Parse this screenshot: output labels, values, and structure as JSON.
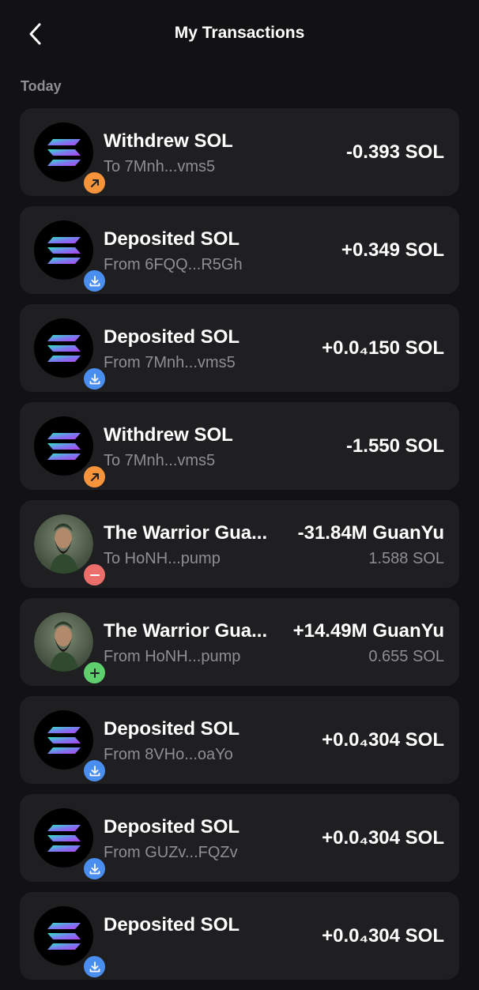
{
  "header": {
    "title": "My Transactions",
    "back_icon": "chevron-left-icon"
  },
  "section": {
    "label": "Today"
  },
  "colors": {
    "background": "#121214",
    "card": "#1f1f22",
    "withdraw_badge": "#f5943a",
    "deposit_badge": "#4a8ff0",
    "sell_badge": "#ec6e6b",
    "buy_badge": "#5fce6d"
  },
  "transactions": [
    {
      "kind": "withdraw",
      "avatar": "solana-logo",
      "badge_icon": "arrow-up-right-icon",
      "name": "Withdrew SOL",
      "sub": "To 7Mnh...vms5",
      "amount": "-0.393 SOL",
      "amount_sub": ""
    },
    {
      "kind": "deposit",
      "avatar": "solana-logo",
      "badge_icon": "download-icon",
      "name": "Deposited SOL",
      "sub": "From 6FQQ...R5Gh",
      "amount": "+0.349 SOL",
      "amount_sub": ""
    },
    {
      "kind": "deposit",
      "avatar": "solana-logo",
      "badge_icon": "download-icon",
      "name": "Deposited SOL",
      "sub": "From 7Mnh...vms5",
      "amount": "+0.0₄150 SOL",
      "amount_sub": ""
    },
    {
      "kind": "withdraw",
      "avatar": "solana-logo",
      "badge_icon": "arrow-up-right-icon",
      "name": "Withdrew SOL",
      "sub": "To 7Mnh...vms5",
      "amount": "-1.550 SOL",
      "amount_sub": ""
    },
    {
      "kind": "sell",
      "avatar": "warrior-token-image",
      "badge_icon": "minus-icon",
      "name": "The Warrior Gua...",
      "sub": "To HoNH...pump",
      "amount": "-31.84M GuanYu",
      "amount_sub": "1.588 SOL"
    },
    {
      "kind": "buy",
      "avatar": "warrior-token-image",
      "badge_icon": "plus-icon",
      "name": "The Warrior Gua...",
      "sub": "From HoNH...pump",
      "amount": "+14.49M GuanYu",
      "amount_sub": "0.655 SOL"
    },
    {
      "kind": "deposit",
      "avatar": "solana-logo",
      "badge_icon": "download-icon",
      "name": "Deposited SOL",
      "sub": "From 8VHo...oaYo",
      "amount": "+0.0₄304 SOL",
      "amount_sub": ""
    },
    {
      "kind": "deposit",
      "avatar": "solana-logo",
      "badge_icon": "download-icon",
      "name": "Deposited SOL",
      "sub": "From GUZv...FQZv",
      "amount": "+0.0₄304 SOL",
      "amount_sub": ""
    },
    {
      "kind": "deposit",
      "avatar": "solana-logo",
      "badge_icon": "download-icon",
      "name": "Deposited SOL",
      "sub": "",
      "amount": "+0.0₄304 SOL",
      "amount_sub": ""
    }
  ]
}
